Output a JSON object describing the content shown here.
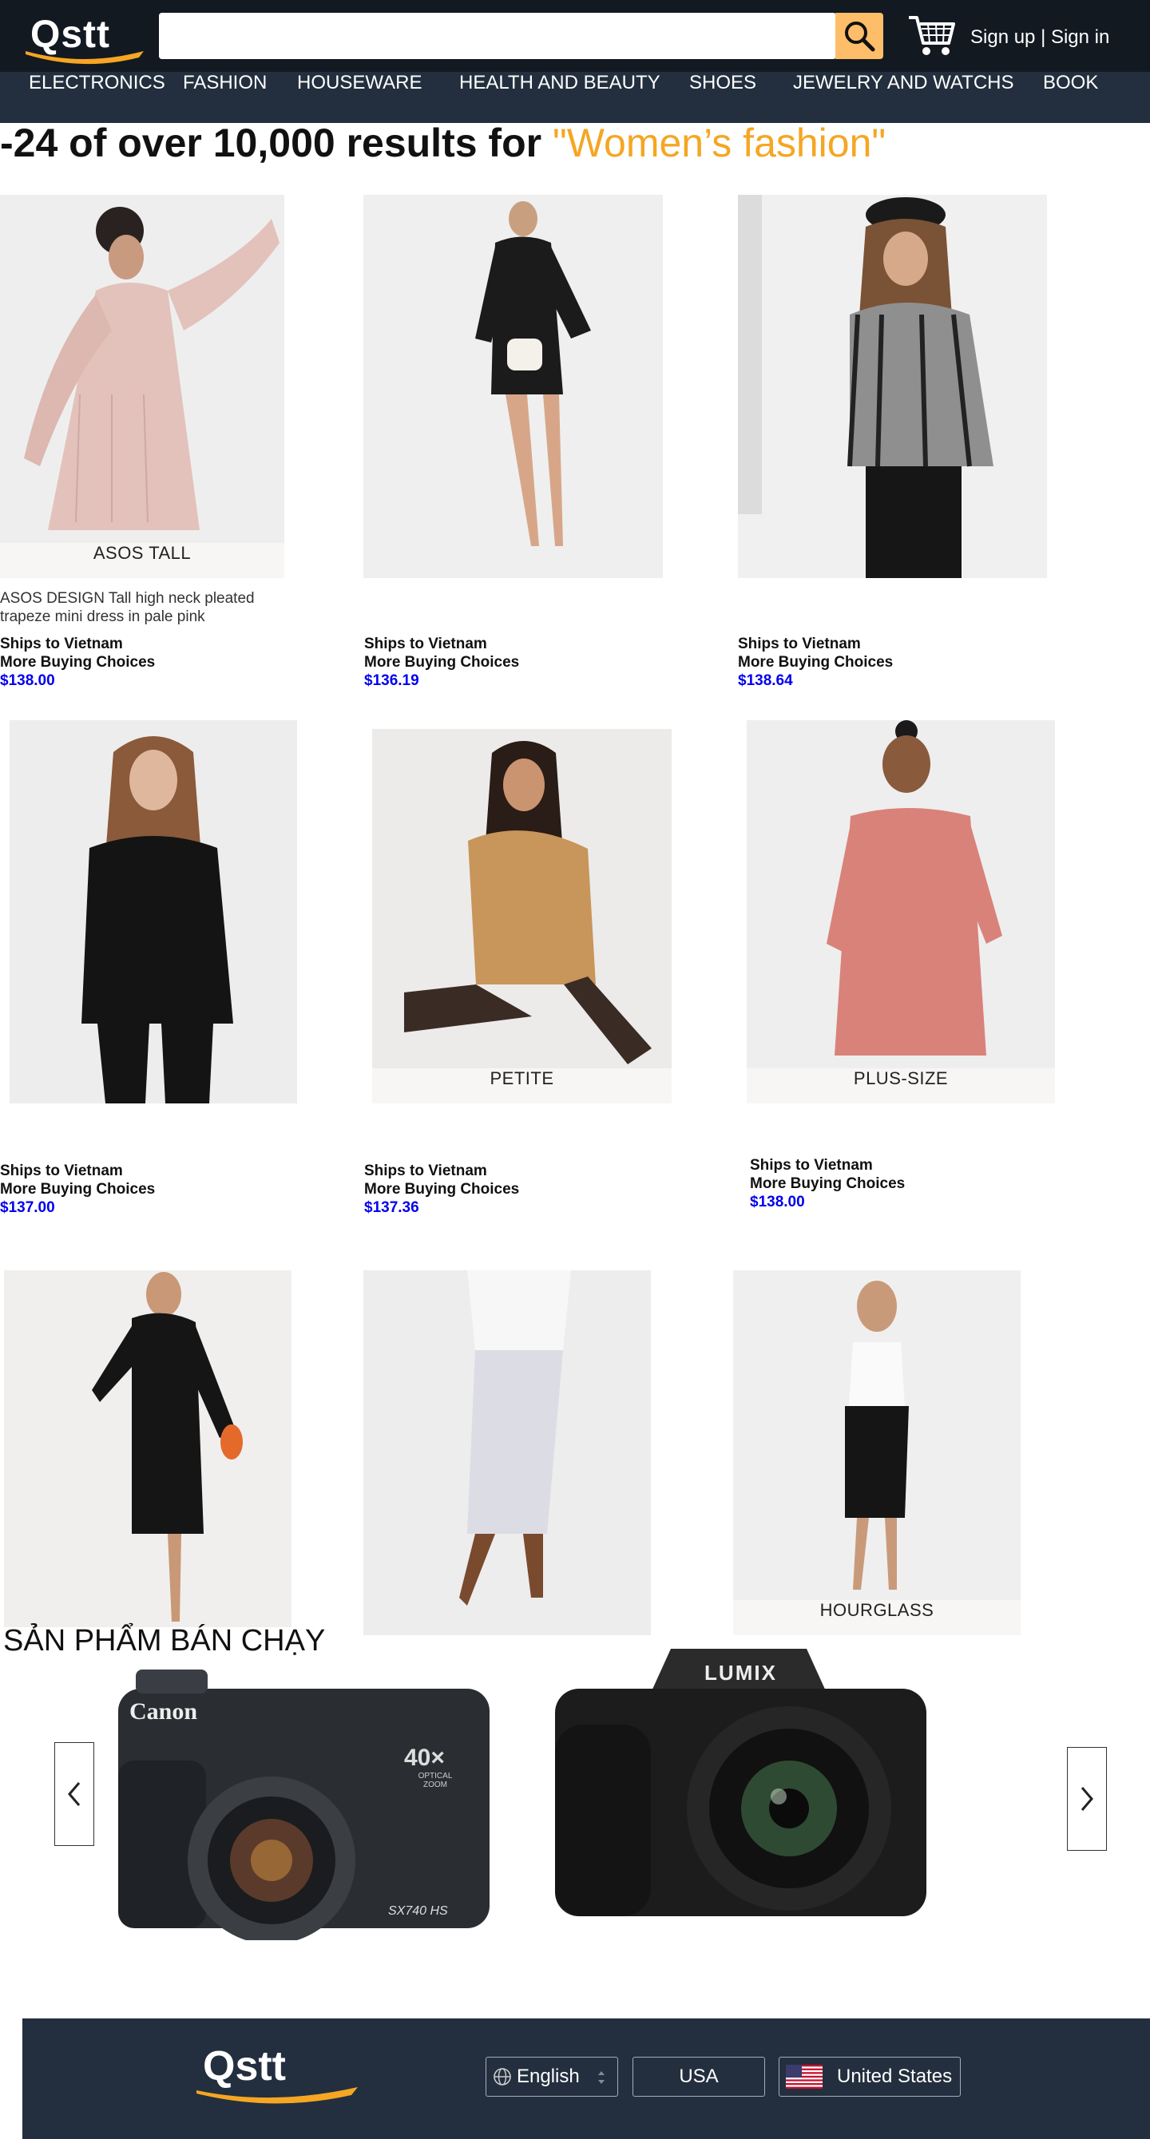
{
  "header": {
    "logo_text": "Qstt",
    "search_value": "",
    "search_placeholder": "",
    "auth_text": "Sign up | Sign in",
    "search_icon": "search-icon",
    "cart_icon": "cart-icon",
    "colors": {
      "topbar": "#131921",
      "nav": "#232f3e",
      "accent": "#febd69",
      "query": "#f5a623",
      "price": "#0000ee"
    }
  },
  "nav": {
    "items": [
      "ELECTRONICS",
      "FASHION",
      "HOUSEWARE",
      "HEALTH AND BEAUTY",
      "SHOES",
      "JEWELRY AND WATCHS",
      "BOOK"
    ]
  },
  "results": {
    "prefix": "-24 of over 10,000 results for ",
    "query": "\"Women’s fashion\""
  },
  "products": [
    {
      "tag": "ASOS TALL",
      "desc": "ASOS DESIGN Tall high neck pleated trapeze mini dress in pale pink",
      "ship": "Ships to Vietnam",
      "choices": "More Buying Choices",
      "price": "$138.00"
    },
    {
      "tag": "",
      "desc": "",
      "ship": "Ships to Vietnam",
      "choices": "More Buying Choices",
      "price": "$136.19"
    },
    {
      "tag": "",
      "desc": "",
      "ship": "Ships to Vietnam",
      "choices": "More Buying Choices",
      "price": "$138.64"
    },
    {
      "tag": "",
      "desc": "",
      "ship": "Ships to Vietnam",
      "choices": "More Buying Choices",
      "price": "$137.00"
    },
    {
      "tag": "PETITE",
      "desc": "",
      "ship": "Ships to Vietnam",
      "choices": "More Buying Choices",
      "price": "$137.36"
    },
    {
      "tag": "PLUS-SIZE",
      "desc": "",
      "ship": "Ships to Vietnam",
      "choices": "More Buying Choices",
      "price": "$138.00"
    },
    {
      "tag": "",
      "desc": "",
      "ship": "",
      "choices": "",
      "price": ""
    },
    {
      "tag": "",
      "desc": "",
      "ship": "",
      "choices": "",
      "price": ""
    },
    {
      "tag": "HOURGLASS",
      "desc": "",
      "ship": "",
      "choices": "",
      "price": ""
    }
  ],
  "bestsellers": {
    "title": "SẢN PHẨM BÁN CHẠY",
    "cameras": [
      {
        "brand": "Canon",
        "zoom": "40×",
        "zoom_sub": "OPTICAL ZOOM",
        "model": "SX740 HS"
      },
      {
        "brand": "LUMIX",
        "zoom": "",
        "zoom_sub": "",
        "model": ""
      }
    ],
    "prev_icon": "chevron-left-icon",
    "next_icon": "chevron-right-icon"
  },
  "footer": {
    "logo_text": "Qstt",
    "language": "English",
    "region": "USA",
    "country": "United States",
    "globe_icon": "globe-icon",
    "flag_icon": "us-flag-icon"
  }
}
